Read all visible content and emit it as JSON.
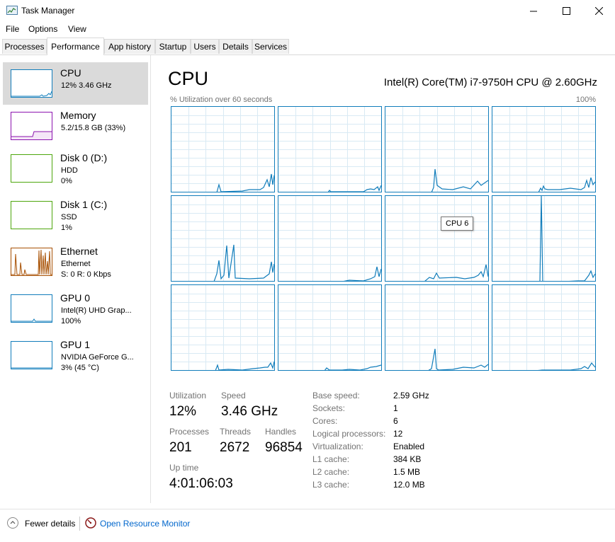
{
  "window": {
    "title": "Task Manager",
    "minimize_icon": "minimize-icon",
    "maximize_icon": "maximize-icon",
    "close_icon": "close-icon"
  },
  "menu": [
    "File",
    "Options",
    "View"
  ],
  "tabs": [
    "Processes",
    "Performance",
    "App history",
    "Startup",
    "Users",
    "Details",
    "Services"
  ],
  "active_tab": "Performance",
  "sidebar": {
    "items": [
      {
        "title": "CPU",
        "sub1": "12%  3.46 GHz",
        "sub2": "",
        "color": "#117dbb"
      },
      {
        "title": "Memory",
        "sub1": "5.2/15.8 GB (33%)",
        "sub2": "",
        "color": "#8b12ae"
      },
      {
        "title": "Disk 0 (D:)",
        "sub1": "HDD",
        "sub2": "0%",
        "color": "#4da60c"
      },
      {
        "title": "Disk 1 (C:)",
        "sub1": "SSD",
        "sub2": "1%",
        "color": "#4da60c"
      },
      {
        "title": "Ethernet",
        "sub1": "Ethernet",
        "sub2": "S: 0  R: 0 Kbps",
        "color": "#a74f01"
      },
      {
        "title": "GPU 0",
        "sub1": "Intel(R) UHD Grap...",
        "sub2": "100%",
        "color": "#117dbb"
      },
      {
        "title": "GPU 1",
        "sub1": "NVIDIA GeForce G...",
        "sub2": "3% (45 °C)",
        "color": "#117dbb"
      }
    ]
  },
  "main": {
    "title": "CPU",
    "model": "Intel(R) Core(TM) i7-9750H CPU @ 2.60GHz",
    "util_label": "% Utilization over 60 seconds",
    "util_max": "100%",
    "tooltip": "CPU 6",
    "graph_color": "#117dbb",
    "grid_color": "#d9eaf4"
  },
  "stats": {
    "utilization_label": "Utilization",
    "utilization": "12%",
    "speed_label": "Speed",
    "speed": "3.46 GHz",
    "processes_label": "Processes",
    "processes": "201",
    "threads_label": "Threads",
    "threads": "2672",
    "handles_label": "Handles",
    "handles": "96854",
    "uptime_label": "Up time",
    "uptime": "4:01:06:03"
  },
  "specs": [
    {
      "label": "Base speed:",
      "value": "2.59 GHz"
    },
    {
      "label": "Sockets:",
      "value": "1"
    },
    {
      "label": "Cores:",
      "value": "6"
    },
    {
      "label": "Logical processors:",
      "value": "12"
    },
    {
      "label": "Virtualization:",
      "value": "Enabled"
    },
    {
      "label": "L1 cache:",
      "value": "384 KB"
    },
    {
      "label": "L2 cache:",
      "value": "1.5 MB"
    },
    {
      "label": "L3 cache:",
      "value": "12.0 MB"
    }
  ],
  "footer": {
    "fewer_details": "Fewer details",
    "open_resource_monitor": "Open Resource Monitor"
  }
}
